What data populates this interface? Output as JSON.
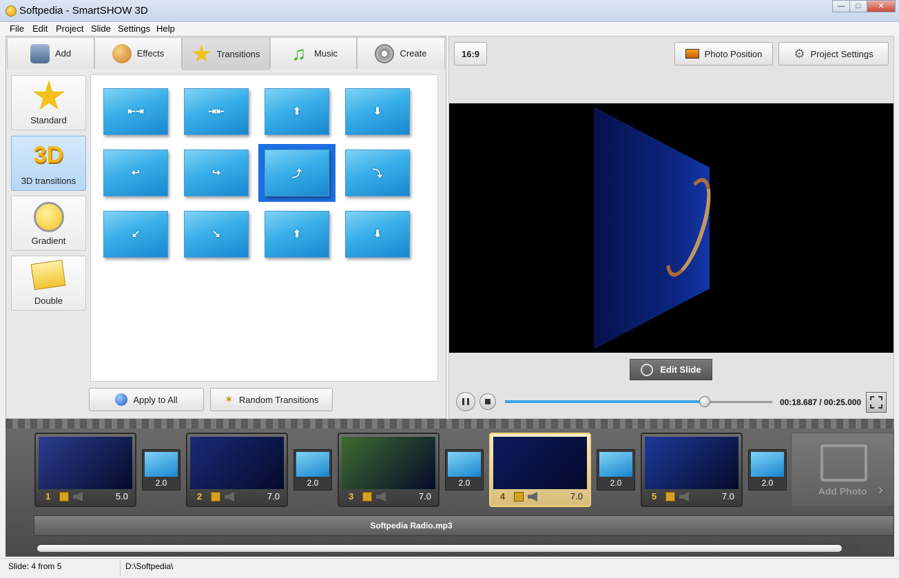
{
  "window": {
    "title": "Softpedia - SmartSHOW 3D",
    "controls": [
      "—",
      "□",
      "✕"
    ]
  },
  "menu": [
    "File",
    "Edit",
    "Project",
    "Slide",
    "Settings",
    "Help"
  ],
  "tabs": [
    {
      "label": "Add",
      "icon": "camera-icon",
      "color": "#5b7fa6"
    },
    {
      "label": "Effects",
      "icon": "palette-icon",
      "color": "#d98b2f"
    },
    {
      "label": "Transitions",
      "icon": "star-icon",
      "color": "#f2c11b"
    },
    {
      "label": "Music",
      "icon": "music-note-icon",
      "color": "#3fae2a"
    },
    {
      "label": "Create",
      "icon": "film-reel-icon",
      "color": "#7a7a7a"
    }
  ],
  "categories": [
    {
      "label": "Standard",
      "icon": "star-icon"
    },
    {
      "label": "3D transitions",
      "icon": "3d-text-icon",
      "badge": "3D"
    },
    {
      "label": "Gradient",
      "icon": "gradient-icon"
    },
    {
      "label": "Double",
      "icon": "double-note-icon"
    }
  ],
  "transition_marks": [
    "⇤⇥",
    "⇥⇤",
    "⬆",
    "⬇",
    "↩",
    "↪",
    "⤴",
    "⤵",
    "↙",
    "↘",
    "⬆",
    "⬇"
  ],
  "selected_transition": 6,
  "buttons": {
    "apply_all": "Apply to All",
    "random": "Random Transitions"
  },
  "toolbar": {
    "ratio": "16:9",
    "photo_position": "Photo Position",
    "project_settings": "Project Settings"
  },
  "preview": {
    "edit_slide": "Edit Slide",
    "timecode": "00:18.687 / 00:25.000",
    "progress": 0.7475
  },
  "timeline": {
    "slides": [
      {
        "num": "1",
        "dur": "5.0",
        "color": "#2b3d8f"
      },
      {
        "num": "2",
        "dur": "7.0",
        "color": "#1a2a78"
      },
      {
        "num": "3",
        "dur": "7.0",
        "color": "#3d6b2f"
      },
      {
        "num": "4",
        "dur": "7.0",
        "color": "#0b1a5e",
        "active": true
      },
      {
        "num": "5",
        "dur": "7.0",
        "color": "#1d3a9a"
      }
    ],
    "transitions": [
      "2.0",
      "2.0",
      "2.0",
      "2.0",
      "2.0"
    ],
    "add_photo": "Add Photo",
    "audio": "Softpedia Radio.mp3"
  },
  "status": {
    "slide": "Slide: 4 from 5",
    "path": "D:\\Softpedia\\"
  }
}
